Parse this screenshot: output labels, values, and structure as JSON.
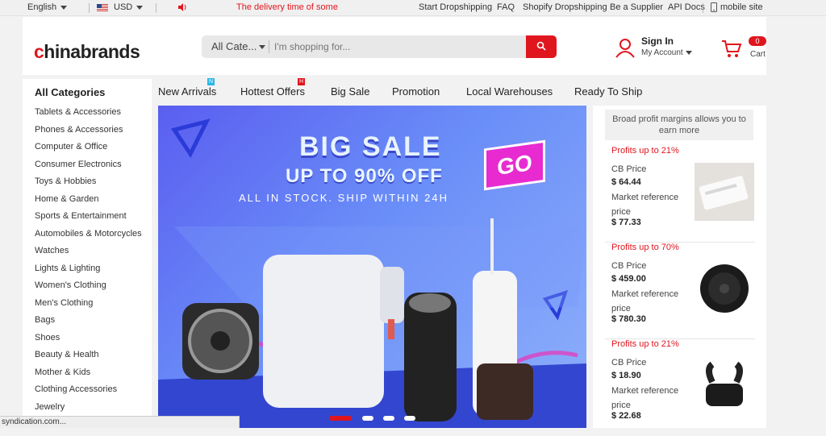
{
  "topbar": {
    "language": "English",
    "currency": "USD",
    "announcement": "The delivery time of some cou",
    "links": [
      "Start Dropshipping",
      "FAQ",
      "Shopify Dropshipping",
      "Be a Supplier",
      "API Docs",
      "mobile site"
    ]
  },
  "header": {
    "logo_c": "c",
    "logo_rest": "hinabrands",
    "search_category": "All Cate...",
    "search_placeholder": "I'm shopping for...",
    "sign_in": "Sign In",
    "my_account": "My Account",
    "cart_count": "0",
    "cart_label": "Cart"
  },
  "sidebar": {
    "title": "All Categories",
    "items": [
      "Tablets & Accessories",
      "Phones & Accessories",
      "Computer & Office",
      "Consumer Electronics",
      "Toys & Hobbies",
      "Home & Garden",
      "Sports & Entertainment",
      "Automobiles & Motorcycles",
      "Watches",
      "Lights & Lighting",
      "Women's Clothing",
      "Men's Clothing",
      "Bags",
      "Shoes",
      "Beauty & Health",
      "Mother & Kids",
      "Clothing Accessories",
      "Jewelry"
    ]
  },
  "nav": {
    "tabs": [
      "New Arrivals",
      "Hottest Offers",
      "Big Sale",
      "Promotion",
      "Local Warehouses",
      "Ready To Ship"
    ],
    "badge_new": "N",
    "badge_hot": "H"
  },
  "banner": {
    "headline": "BIG SALE",
    "subhead": "UP TO 90% OFF",
    "tagline": "ALL IN STOCK. SHIP WITHIN 24H",
    "cta": "GO"
  },
  "right_panel": {
    "promo": "Broad profit margins allows you to earn more",
    "products": [
      {
        "profit": "Profits up to 21%",
        "cb_label": "CB Price",
        "cb_price": "$ 64.44",
        "market_label": "Market reference price",
        "market_price": "$ 77.33"
      },
      {
        "profit": "Profits up to 70%",
        "cb_label": "CB Price",
        "cb_price": "$ 459.00",
        "market_label": "Market reference price",
        "market_price": "$ 780.30"
      },
      {
        "profit": "Profits up to 21%",
        "cb_label": "CB Price",
        "cb_price": "$ 18.90",
        "market_label": "Market reference price",
        "market_price": "$ 22.68"
      }
    ]
  },
  "status_bar": "syndication.com...",
  "colors": {
    "accent": "#e0161e",
    "banner": "#6a8ef8"
  }
}
